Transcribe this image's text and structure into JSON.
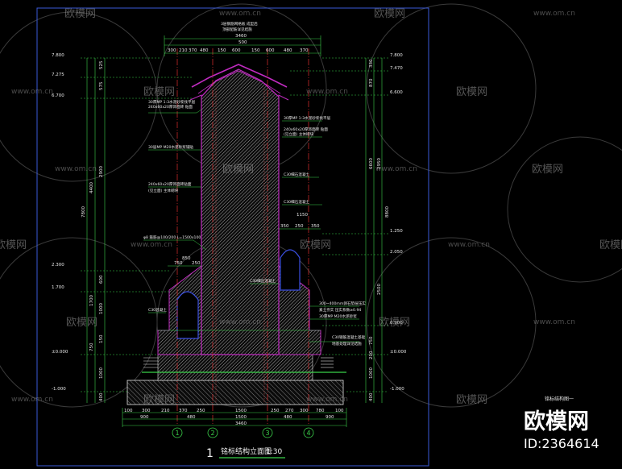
{
  "drawing": {
    "title": "铭标结构立面图",
    "number": "1",
    "scale": "1:30",
    "side_caption": "铭标结构图一",
    "top_note": "3层钢筋网格板 成型后",
    "axes": [
      "1",
      "2",
      "3",
      "4"
    ]
  },
  "watermark": {
    "brand": "欧模网",
    "url": "www.om.cn",
    "big_brand": "欧模网",
    "id_text": "ID:2364614"
  },
  "dims": {
    "top_total": "3460",
    "top_mid": "500",
    "top_row": [
      "300",
      "210",
      "370",
      "480",
      "150",
      "600",
      "150",
      "600",
      "480",
      "370"
    ],
    "bottom_row1": [
      "100",
      "300",
      "210",
      "370",
      "250",
      "1500",
      "250",
      "270",
      "300",
      "780",
      "100"
    ],
    "bottom_row2": [
      "900",
      "480",
      "1500",
      "480",
      "900"
    ],
    "bottom_total": "3460",
    "right_span_a": "1150",
    "right_span_b": [
      "350",
      "250",
      "350"
    ],
    "left_inner": [
      "850",
      "750",
      "250"
    ]
  },
  "levels_left": [
    "7.800",
    "7.275",
    "6.700",
    "2.300",
    "1.700",
    "±0.000",
    "-1.000"
  ],
  "levels_right": [
    "7.800",
    "7.470",
    "6.600",
    "1.250",
    "2.050",
    "0.900",
    "±0.000",
    "-1.000"
  ],
  "vertical_dims_left": [
    "525",
    "575",
    "2900",
    "4400",
    "7800",
    "600",
    "1000",
    "1700",
    "150",
    "750",
    "1000",
    "400"
  ],
  "vertical_dims_right": [
    "330",
    "870",
    "6600",
    "2950",
    "8800",
    "2500",
    "750",
    "200",
    "1000",
    "400"
  ],
  "notes": [
    "3层钢筋网格板 成型后",
    "顶部配筋详见结施",
    "30厚MP 1:3水泥砂浆找平层",
    "240x60x20厚饰面砖 贴面",
    "(见立面) 主体砌块",
    "C30细石混凝土",
    "30层MP M20水泥砂浆铺贴",
    "240x60x20厚饰面砖贴面",
    "C30细石混凝土",
    "φ8 箍筋@100/200 L=1500x100",
    "C30混凝土",
    "C30细石混凝土",
    "300~400mm卵石垫层压实",
    "素土夯实 压实系数≥0.94",
    "30厚MP M20水泥砂浆",
    "C30钢筋混凝土基础",
    "地基处理详见结施"
  ]
}
